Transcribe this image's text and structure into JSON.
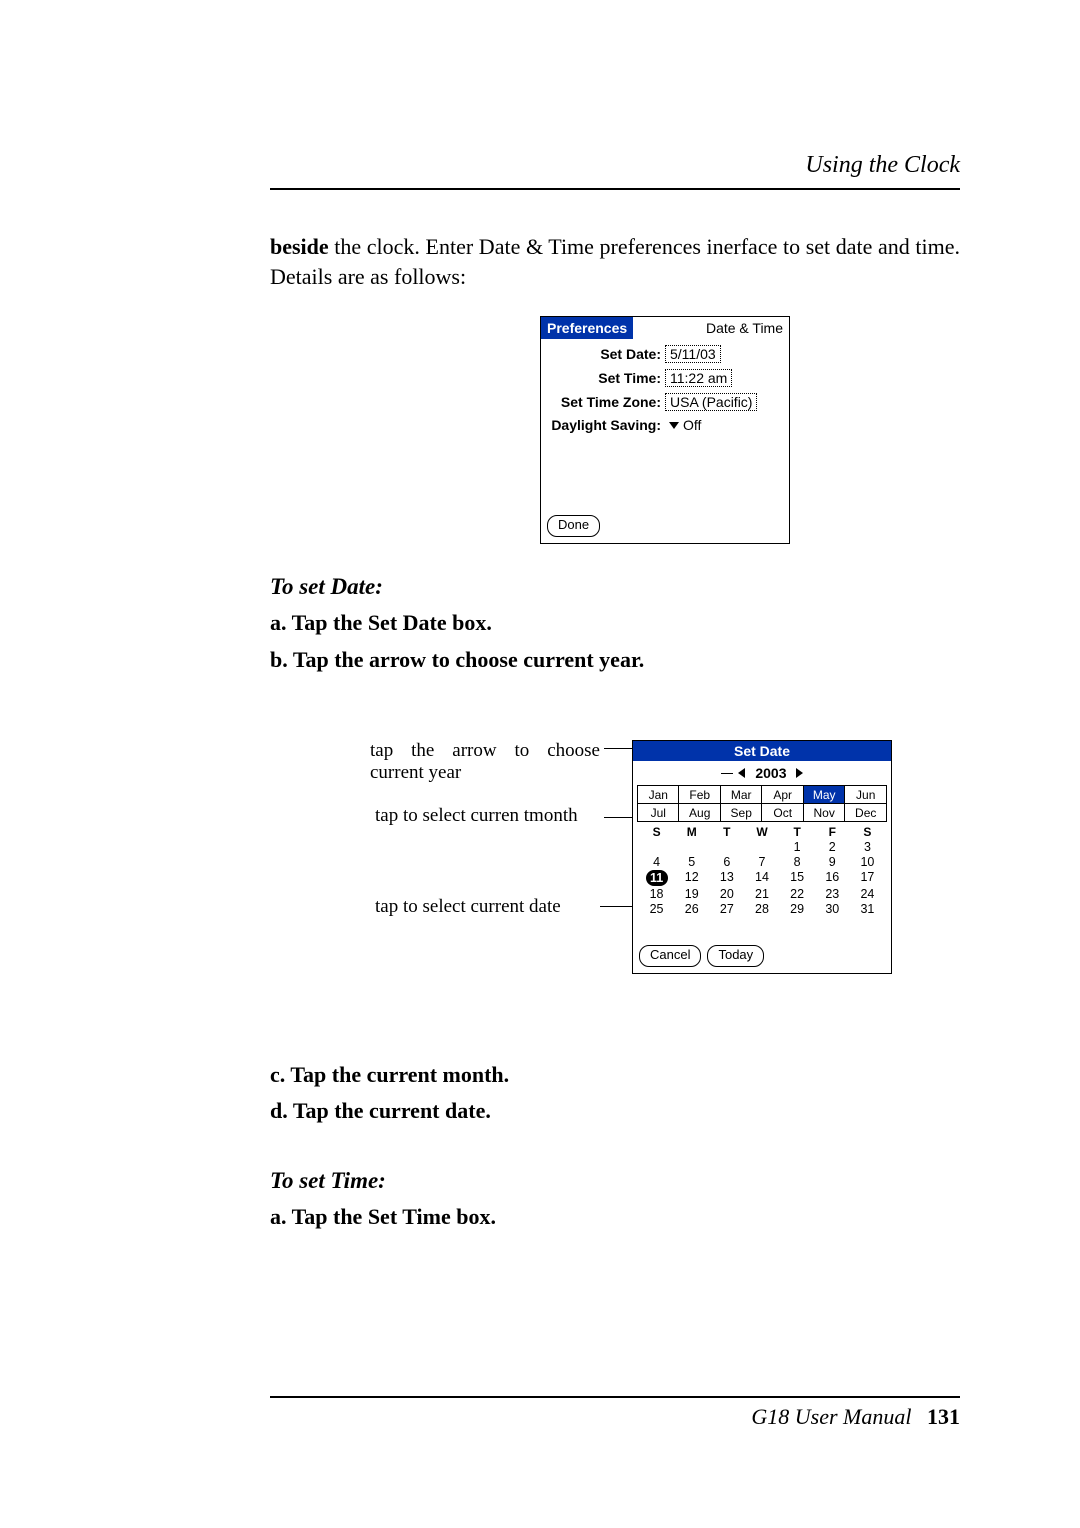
{
  "header": {
    "title": "Using the Clock"
  },
  "intro": {
    "bold": "beside",
    "rest": " the clock. Enter Date & Time preferences inerface to set date and time. Details are as follows:"
  },
  "prefs": {
    "titlebar_left": "Preferences",
    "titlebar_right": "Date & Time",
    "rows": {
      "set_date_label": "Set Date:",
      "set_date_value": "5/11/03",
      "set_time_label": "Set Time:",
      "set_time_value": "11:22 am",
      "set_tz_label": "Set Time Zone:",
      "set_tz_value": "USA (Pacific)",
      "dls_label": "Daylight Saving:",
      "dls_value": "Off"
    },
    "done": "Done"
  },
  "sections": {
    "to_set_date": "To set Date:",
    "to_set_time": "To set Time:"
  },
  "steps_date": {
    "a": "a.   Tap the Set Date box.",
    "b": "b.   Tap the arrow to choose current year.",
    "c": "c.   Tap the current month.",
    "d": "d.   Tap the current date."
  },
  "steps_time": {
    "a": "a.   Tap the Set Time box."
  },
  "annotations": {
    "year": "tap the arrow to choose current year",
    "month": "tap to select curren tmonth",
    "date": "tap to select current date"
  },
  "setdate": {
    "title": "Set Date",
    "year": "2003",
    "months_row1": [
      "Jan",
      "Feb",
      "Mar",
      "Apr",
      "May",
      "Jun"
    ],
    "months_row2": [
      "Jul",
      "Aug",
      "Sep",
      "Oct",
      "Nov",
      "Dec"
    ],
    "selected_month_index": 4,
    "dow": [
      "S",
      "M",
      "T",
      "W",
      "T",
      "F",
      "S"
    ],
    "grid": [
      [
        "",
        "",
        "",
        "",
        "1",
        "2",
        "3"
      ],
      [
        "4",
        "5",
        "6",
        "7",
        "8",
        "9",
        "10"
      ],
      [
        "11",
        "12",
        "13",
        "14",
        "15",
        "16",
        "17"
      ],
      [
        "18",
        "19",
        "20",
        "21",
        "22",
        "23",
        "24"
      ],
      [
        "25",
        "26",
        "27",
        "28",
        "29",
        "30",
        "31"
      ]
    ],
    "selected_day": "11",
    "cancel": "Cancel",
    "today": "Today"
  },
  "footer": {
    "manual": "G18 User Manual",
    "page": "131"
  }
}
